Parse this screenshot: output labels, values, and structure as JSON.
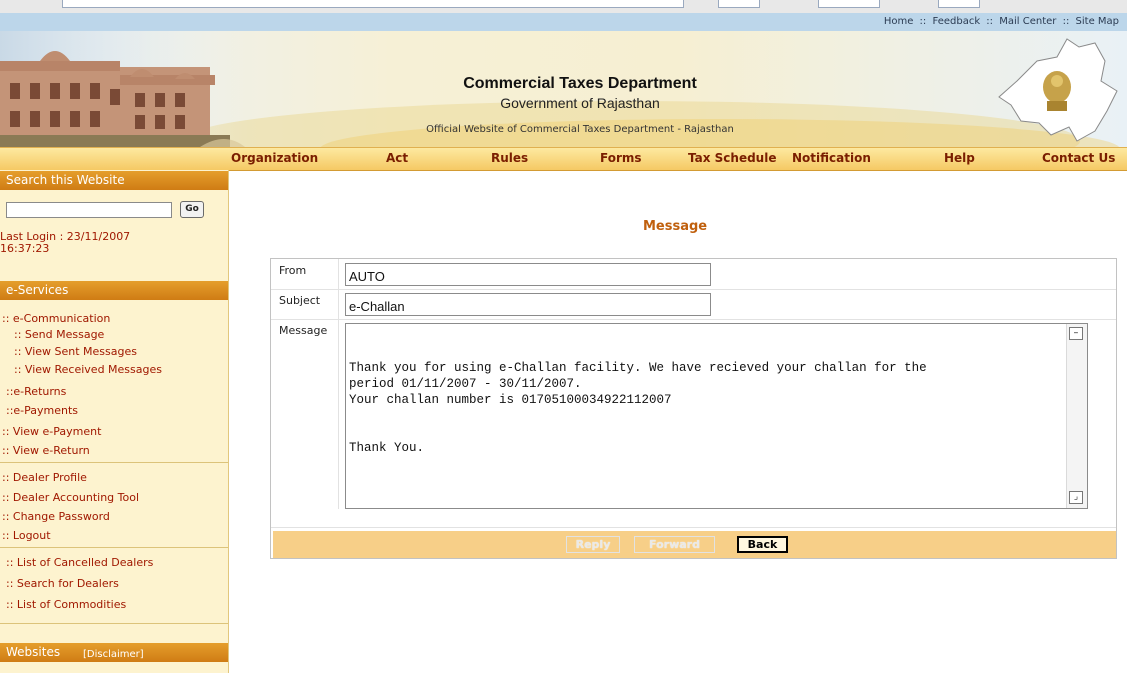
{
  "top_links": [
    "Home",
    "Feedback",
    "Mail Center",
    "Site Map"
  ],
  "top_links_sep": "::",
  "header": {
    "title": "Commercial Taxes Department",
    "subtitle": "Government of Rajasthan",
    "tagline": "Official Website of Commercial Taxes Department - Rajasthan"
  },
  "nav": [
    "Organization",
    "Act",
    "Rules",
    "Forms",
    "Tax Schedule",
    "Notification",
    "Help",
    "Contact Us"
  ],
  "sidebar": {
    "search_heading": "Search this Website",
    "search_value": "",
    "go_label": "Go",
    "last_login_label": "Last Login : 23/11/2007",
    "last_login_time": "16:37:23",
    "eservices_heading": "e-Services",
    "links": {
      "e_communication": ":: e-Communication",
      "send_message": ":: Send Message",
      "view_sent": ":: View Sent Messages",
      "view_received": ":: View Received Messages",
      "e_returns": "::e-Returns",
      "e_payments": "::e-Payments",
      "view_e_payment": ":: View e-Payment",
      "view_e_return": ":: View e-Return",
      "dealer_profile": ":: Dealer Profile",
      "dealer_accounting": ":: Dealer Accounting Tool",
      "change_password": ":: Change Password",
      "logout": ":: Logout",
      "cancelled_dealers": ":: List of Cancelled Dealers",
      "search_dealers": ":: Search for Dealers",
      "commodities": ":: List of Commodities"
    },
    "websites_heading": "Websites",
    "disclaimer": "[Disclaimer]"
  },
  "message": {
    "title": "Message",
    "from_label": "From",
    "from_value": "AUTO",
    "subject_label": "Subject",
    "subject_value": "e-Challan",
    "message_label": "Message",
    "body": "Thank you for using e-Challan facility. We have recieved your challan for the\nperiod 01/11/2007 - 30/11/2007.\nYour challan number is 01705100034922112007\n\n\nThank You.",
    "reply_label": "Reply",
    "forward_label": "Forward",
    "back_label": "Back"
  }
}
